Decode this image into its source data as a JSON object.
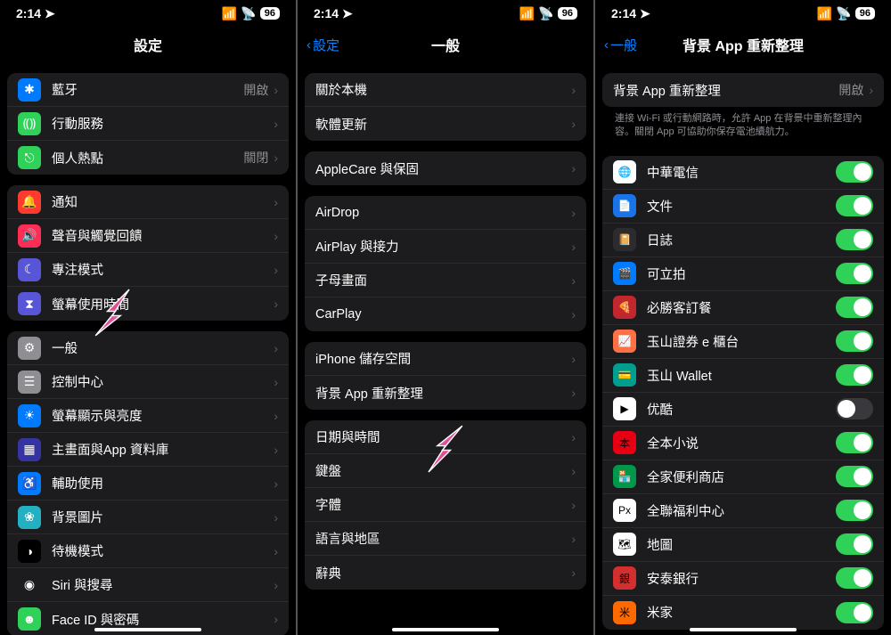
{
  "status": {
    "time": "2:14",
    "battery": "96"
  },
  "screen1": {
    "title": "設定",
    "group1": [
      {
        "id": "bluetooth",
        "icon_bg": "#007aff",
        "glyph": "✱",
        "label": "藍牙",
        "value": "開啟"
      },
      {
        "id": "cellular",
        "icon_bg": "#30d158",
        "glyph": "⸨⸩",
        "label": "行動服務",
        "value": ""
      },
      {
        "id": "hotspot",
        "icon_bg": "#30d158",
        "glyph": "⎋",
        "label": "個人熱點",
        "value": "關閉"
      }
    ],
    "group2": [
      {
        "id": "notifications",
        "icon_bg": "#ff3b30",
        "glyph": "🔔",
        "label": "通知"
      },
      {
        "id": "sounds",
        "icon_bg": "#ff2d55",
        "glyph": "🔊",
        "label": "聲音與觸覺回饋"
      },
      {
        "id": "focus",
        "icon_bg": "#5856d6",
        "glyph": "☾",
        "label": "專注模式"
      },
      {
        "id": "screentime",
        "icon_bg": "#5856d6",
        "glyph": "⧗",
        "label": "螢幕使用時間"
      }
    ],
    "group3": [
      {
        "id": "general",
        "icon_bg": "#8e8e93",
        "glyph": "⚙",
        "label": "一般"
      },
      {
        "id": "control-center",
        "icon_bg": "#8e8e93",
        "glyph": "☰",
        "label": "控制中心"
      },
      {
        "id": "display",
        "icon_bg": "#007aff",
        "glyph": "☀",
        "label": "螢幕顯示與亮度"
      },
      {
        "id": "home-screen",
        "icon_bg": "#3634a3",
        "glyph": "▦",
        "label": "主畫面與App 資料庫"
      },
      {
        "id": "accessibility",
        "icon_bg": "#007aff",
        "glyph": "♿",
        "label": "輔助使用"
      },
      {
        "id": "wallpaper",
        "icon_bg": "#23b0c3",
        "glyph": "❀",
        "label": "背景圖片"
      },
      {
        "id": "standby",
        "icon_bg": "#000000",
        "glyph": "◑",
        "label": "待機模式"
      },
      {
        "id": "siri",
        "icon_bg": "#1c1c1e",
        "glyph": "◉",
        "label": "Siri 與搜尋",
        "siri": true
      },
      {
        "id": "faceid",
        "icon_bg": "#30d158",
        "glyph": "☻",
        "label": "Face ID 與密碼"
      }
    ],
    "arrow_target_label": "一般"
  },
  "screen2": {
    "back": "設定",
    "title": "一般",
    "groups": [
      [
        {
          "id": "about",
          "label": "關於本機"
        },
        {
          "id": "software-update",
          "label": "軟體更新"
        }
      ],
      [
        {
          "id": "applecare",
          "label": "AppleCare 與保固"
        }
      ],
      [
        {
          "id": "airdrop",
          "label": "AirDrop"
        },
        {
          "id": "airplay",
          "label": "AirPlay 與接力"
        },
        {
          "id": "pip",
          "label": "子母畫面"
        },
        {
          "id": "carplay",
          "label": "CarPlay"
        }
      ],
      [
        {
          "id": "storage",
          "label": "iPhone 儲存空間"
        },
        {
          "id": "bg-refresh",
          "label": "背景 App 重新整理"
        }
      ],
      [
        {
          "id": "datetime",
          "label": "日期與時間"
        },
        {
          "id": "keyboard",
          "label": "鍵盤"
        },
        {
          "id": "fonts",
          "label": "字體"
        },
        {
          "id": "language",
          "label": "語言與地區"
        },
        {
          "id": "dictionary",
          "label": "辭典"
        }
      ]
    ],
    "arrow_target_label": "背景 App 重新整理"
  },
  "screen3": {
    "back": "一般",
    "title": "背景 App 重新整理",
    "top_row": {
      "label": "背景 App 重新整理",
      "value": "開啟"
    },
    "footer": "連接 Wi-Fi 或行動網路時，允許 App 在背景中重新整理內容。關閉 App 可協助你保存電池續航力。",
    "apps": [
      {
        "id": "cht",
        "icon_bg": "#ffffff",
        "glyph": "🌐",
        "label": "中華電信",
        "on": true
      },
      {
        "id": "docs",
        "icon_bg": "#1a73e8",
        "glyph": "📄",
        "label": "文件",
        "on": true
      },
      {
        "id": "journal",
        "icon_bg": "#2c2c2e",
        "glyph": "📔",
        "label": "日誌",
        "on": true
      },
      {
        "id": "clips",
        "icon_bg": "#007aff",
        "glyph": "🎬",
        "label": "可立拍",
        "on": true
      },
      {
        "id": "pizza",
        "icon_bg": "#c1272d",
        "glyph": "🍕",
        "label": "必勝客訂餐",
        "on": true
      },
      {
        "id": "esun-sec",
        "icon_bg": "#ff7043",
        "glyph": "📈",
        "label": "玉山證券 e 櫃台",
        "on": true
      },
      {
        "id": "esun-wallet",
        "icon_bg": "#009e8e",
        "glyph": "💳",
        "label": "玉山 Wallet",
        "on": true
      },
      {
        "id": "youku",
        "icon_bg": "#ffffff",
        "glyph": "▶",
        "label": "优酷",
        "on": false
      },
      {
        "id": "novel",
        "icon_bg": "#e60012",
        "glyph": "本",
        "label": "全本小说",
        "on": true
      },
      {
        "id": "familymart",
        "icon_bg": "#00974b",
        "glyph": "🏪",
        "label": "全家便利商店",
        "on": true
      },
      {
        "id": "pxpay",
        "icon_bg": "#ffffff",
        "glyph": "Px",
        "label": "全聯福利中心",
        "on": true
      },
      {
        "id": "maps",
        "icon_bg": "#ffffff",
        "glyph": "🗺",
        "label": "地圖",
        "on": true
      },
      {
        "id": "entie",
        "icon_bg": "#d32f2f",
        "glyph": "銀",
        "label": "安泰銀行",
        "on": true
      },
      {
        "id": "mijia",
        "icon_bg": "#ff6900",
        "glyph": "米",
        "label": "米家",
        "on": true
      }
    ]
  }
}
